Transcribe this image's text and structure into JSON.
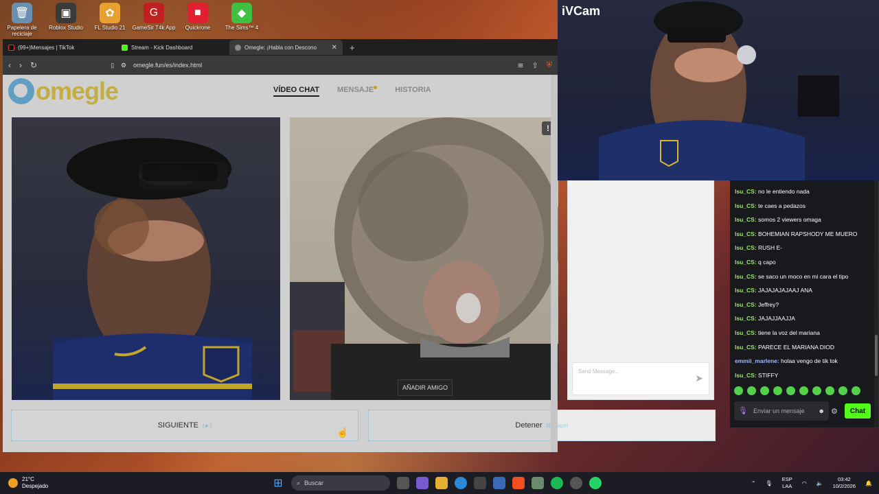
{
  "desktop": {
    "icons": [
      {
        "label": "Papelera de reciclaje",
        "icon": "recycle-bin-icon",
        "color": "#6a8fb0"
      },
      {
        "label": "Roblox Studio",
        "icon": "roblox-studio-icon",
        "color": "#3a3a3a"
      },
      {
        "label": "FL Studio 21",
        "icon": "fl-studio-icon",
        "color": "#e8a030"
      },
      {
        "label": "GameSir T4k App",
        "icon": "gamesir-icon",
        "color": "#c02020"
      },
      {
        "label": "Quickrone",
        "icon": "quickrone-icon",
        "color": "#e02030"
      },
      {
        "label": "The Sims™ 4",
        "icon": "sims-icon",
        "color": "#40c040"
      }
    ]
  },
  "browser": {
    "tabs": [
      {
        "label": "(99+)Mensajes | TikTok",
        "icon": "tiktok-icon",
        "color": "#111"
      },
      {
        "label": "Stream - Kick Dashboard",
        "icon": "kick-icon",
        "color": "#53fc18"
      },
      {
        "label": "Omegle: ¡Habla con Descono",
        "icon": "omegle-icon",
        "color": "#888"
      }
    ],
    "new_tab": "+",
    "url": "omegle.fun/es/index.html"
  },
  "site": {
    "logo": "omegle",
    "nav": {
      "video_chat": "VÍDEO CHAT",
      "mensaje": "MENSAJE",
      "historia": "HISTORIA"
    },
    "add_friend": "AÑADIR AMIGO",
    "report": "!",
    "send_placeholder": "Send Message...",
    "next_button": "SIGUIENTE",
    "next_hint": "(►)",
    "stop_button": "Detener",
    "stop_hint": "(Escape)"
  },
  "ivcam": {
    "title": "iVCam"
  },
  "kick_chat": {
    "messages": [
      {
        "user": "lsu_CS:",
        "text": "no le entiendo nada"
      },
      {
        "user": "lsu_CS:",
        "text": "te caes a pedazos"
      },
      {
        "user": "lsu_CS:",
        "text": "somos 2 viewers omaga"
      },
      {
        "user": "lsu_CS:",
        "text": "BOHEMIAN RAPSHODY ME MUERO"
      },
      {
        "user": "lsu_CS:",
        "text": "RUSH E-"
      },
      {
        "user": "lsu_CS:",
        "text": "q capo"
      },
      {
        "user": "lsu_CS:",
        "text": "se saco un moco en mi cara el tipo"
      },
      {
        "user": "lsu_CS:",
        "text": "JAJAJAJAJAAJ ANA"
      },
      {
        "user": "lsu_CS:",
        "text": "Jeffrey?"
      },
      {
        "user": "lsu_CS:",
        "text": "JAJAJJAAJJA"
      },
      {
        "user": "lsu_CS:",
        "text": "tiene la voz del mariana"
      },
      {
        "user": "lsu_CS:",
        "text": "PARECE EL MARIANA DIOD"
      },
      {
        "user": "emmii_marlene:",
        "text": "holaa vengo de tik tok"
      },
      {
        "user": "lsu_CS:",
        "text": "STIFFY"
      }
    ],
    "input_placeholder": "Enviar un mensaje",
    "chat_button": "Chat",
    "accent": "#53fc18"
  },
  "taskbar": {
    "temperature": "21°C",
    "weather": "Despejado",
    "search": "Buscar",
    "lang_top": "ESP",
    "lang_bottom": "LAA",
    "time": "03:42",
    "date": "10/2/2026"
  }
}
